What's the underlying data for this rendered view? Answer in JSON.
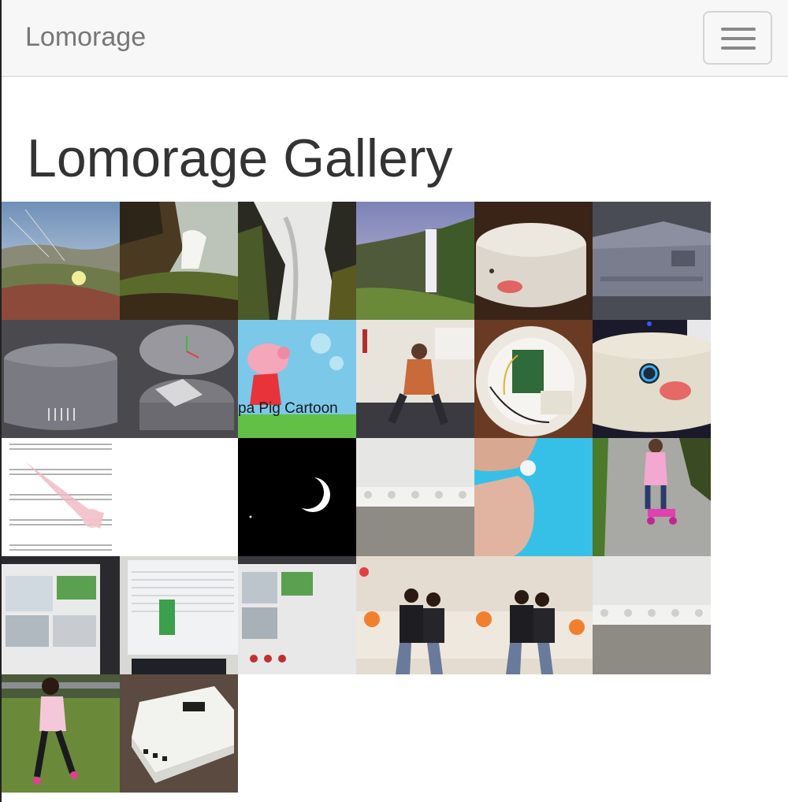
{
  "navbar": {
    "brand": "Lomorage",
    "menu_icon": "hamburger-icon"
  },
  "page": {
    "title": "Lomorage Gallery"
  },
  "gallery": {
    "photos": [
      {
        "subject": "ice plant flowers on dune"
      },
      {
        "subject": "waterfall cliff"
      },
      {
        "subject": "long exposure waterfall"
      },
      {
        "subject": "waterfall valley"
      },
      {
        "subject": "round white device with red light"
      },
      {
        "subject": "3d render enclosure"
      },
      {
        "subject": "3d cad model round enclosure"
      },
      {
        "subject": "peppa pig cartoon",
        "overlay_text": "pa Pig Cartoon"
      },
      {
        "subject": "person dancing in office"
      },
      {
        "subject": "raspberry pi in round enclosure"
      },
      {
        "subject": "device with blue ring button"
      },
      {
        "subject": "guitar sheet music"
      },
      {
        "subject": "crescent moon"
      },
      {
        "subject": "white printed part"
      },
      {
        "subject": "small gem between fingers"
      },
      {
        "subject": "child on scooter"
      },
      {
        "subject": "video call screen"
      },
      {
        "subject": "monitor with spreadsheet"
      },
      {
        "subject": "video call screen 2"
      },
      {
        "subject": "two people on sofa"
      },
      {
        "subject": "two people on sofa 2"
      },
      {
        "subject": "white printed part 2"
      },
      {
        "subject": "child walking on grass"
      },
      {
        "subject": "white box device"
      }
    ]
  }
}
